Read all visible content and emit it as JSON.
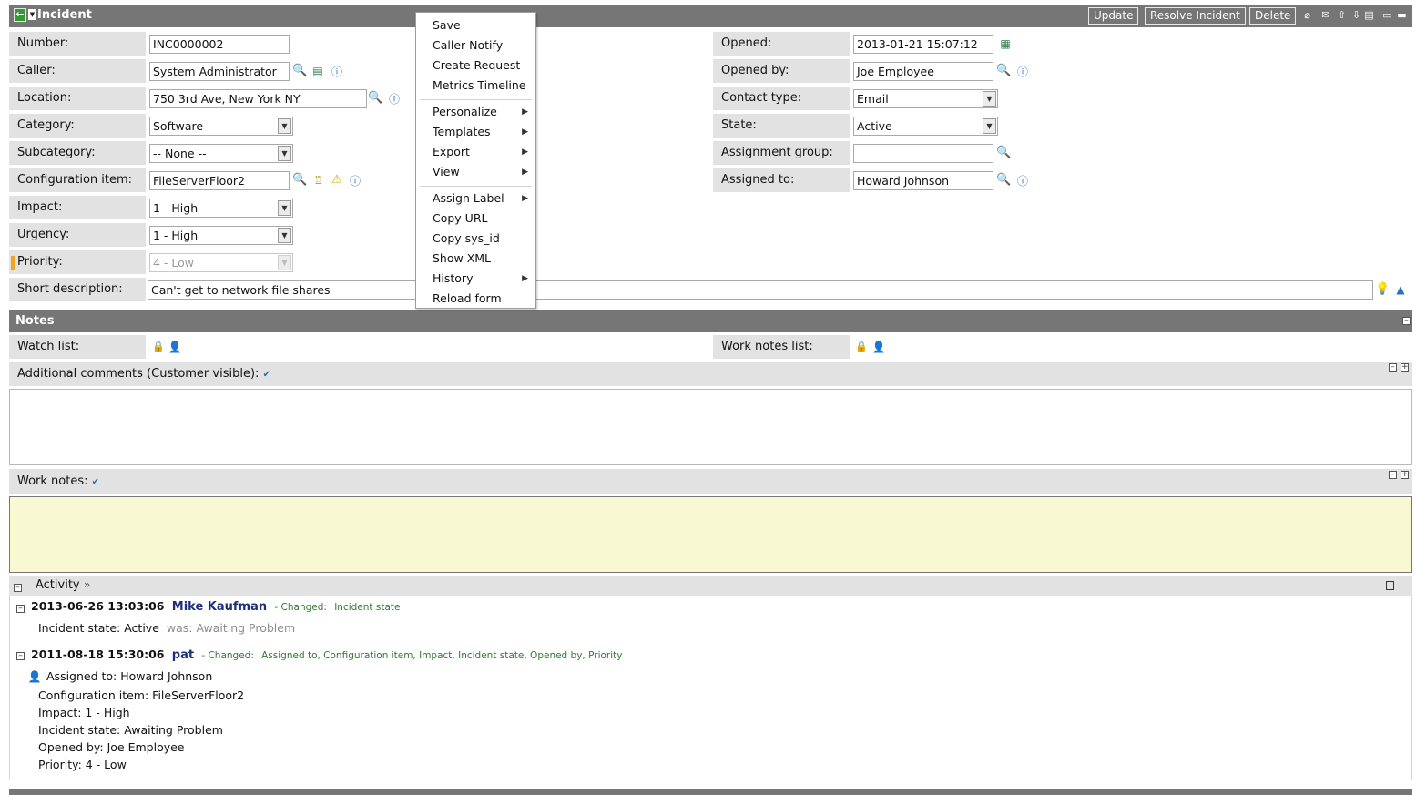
{
  "header": {
    "title": "Incident",
    "update_label": "Update",
    "resolve_label": "Resolve Incident",
    "delete_label": "Delete"
  },
  "form": {
    "number": {
      "label": "Number:",
      "value": "INC0000002"
    },
    "caller": {
      "label": "Caller:",
      "value": "System Administrator"
    },
    "location": {
      "label": "Location:",
      "value": "750 3rd Ave, New York NY"
    },
    "category": {
      "label": "Category:",
      "value": "Software"
    },
    "subcategory": {
      "label": "Subcategory:",
      "value": "-- None --"
    },
    "config_item": {
      "label": "Configuration item:",
      "value": "FileServerFloor2"
    },
    "impact": {
      "label": "Impact:",
      "value": "1 - High"
    },
    "urgency": {
      "label": "Urgency:",
      "value": "1 - High"
    },
    "priority": {
      "label": "Priority:",
      "value": "4 - Low"
    },
    "short_description": {
      "label": "Short description:",
      "value": "Can't get to network file shares"
    },
    "opened": {
      "label": "Opened:",
      "value": "2013-01-21 15:07:12"
    },
    "opened_by": {
      "label": "Opened by:",
      "value": "Joe Employee"
    },
    "contact_type": {
      "label": "Contact type:",
      "value": "Email"
    },
    "state": {
      "label": "State:",
      "value": "Active"
    },
    "assignment_group": {
      "label": "Assignment group:",
      "value": ""
    },
    "assigned_to": {
      "label": "Assigned to:",
      "value": "Howard Johnson"
    }
  },
  "notes": {
    "title": "Notes",
    "watch_list_label": "Watch list:",
    "work_notes_list_label": "Work notes list:",
    "additional_comments_label": "Additional comments (Customer visible):",
    "work_notes_label": "Work notes:"
  },
  "activity": {
    "title": "Activity",
    "entries": [
      {
        "date": "2013-06-26 13:03:06",
        "user": "Mike Kaufman",
        "changed_prefix": "- Changed:",
        "changed": "Incident state",
        "lines": [
          {
            "text": "Incident state: Active",
            "was": "was: Awaiting Problem"
          }
        ]
      },
      {
        "date": "2011-08-18 15:30:06",
        "user": "pat",
        "changed_prefix": "- Changed:",
        "changed": "Assigned to, Configuration item, Impact, Incident state, Opened by, Priority",
        "lines": [
          {
            "text": "Assigned to: Howard Johnson"
          },
          {
            "text": "Configuration item: FileServerFloor2"
          },
          {
            "text": "Impact: 1 - High"
          },
          {
            "text": "Incident state: Awaiting Problem"
          },
          {
            "text": "Opened by: Joe Employee"
          },
          {
            "text": "Priority: 4 - Low"
          }
        ]
      }
    ]
  },
  "context_menu": {
    "items": [
      {
        "label": "Save"
      },
      {
        "label": "Caller Notify"
      },
      {
        "label": "Create Request"
      },
      {
        "label": "Metrics Timeline"
      },
      {
        "label": "Personalize"
      },
      {
        "label": "Templates"
      },
      {
        "label": "Export"
      },
      {
        "label": "View"
      },
      {
        "label": "Assign Label"
      },
      {
        "label": "Copy URL"
      },
      {
        "label": "Copy sys_id"
      },
      {
        "label": "Show XML"
      },
      {
        "label": "History"
      },
      {
        "label": "Reload form"
      }
    ],
    "submenu_glyph": "▶"
  },
  "icons": {
    "back": "arrow-left-icon",
    "search": "search-icon",
    "reference": "reference-info-icon",
    "calendar": "calendar-icon",
    "warning": "warning-icon",
    "lock": "lock-icon",
    "person": "person-icon",
    "spellcheck": "spellcheck-icon"
  },
  "colors": {
    "header_bg": "#767676",
    "label_bg": "#e2e2e2",
    "work_notes_bg": "#f8f8d2",
    "priority_marker": "#f5a21f",
    "user_link": "#1e2f7a",
    "changed_text": "#2f7a2f"
  }
}
